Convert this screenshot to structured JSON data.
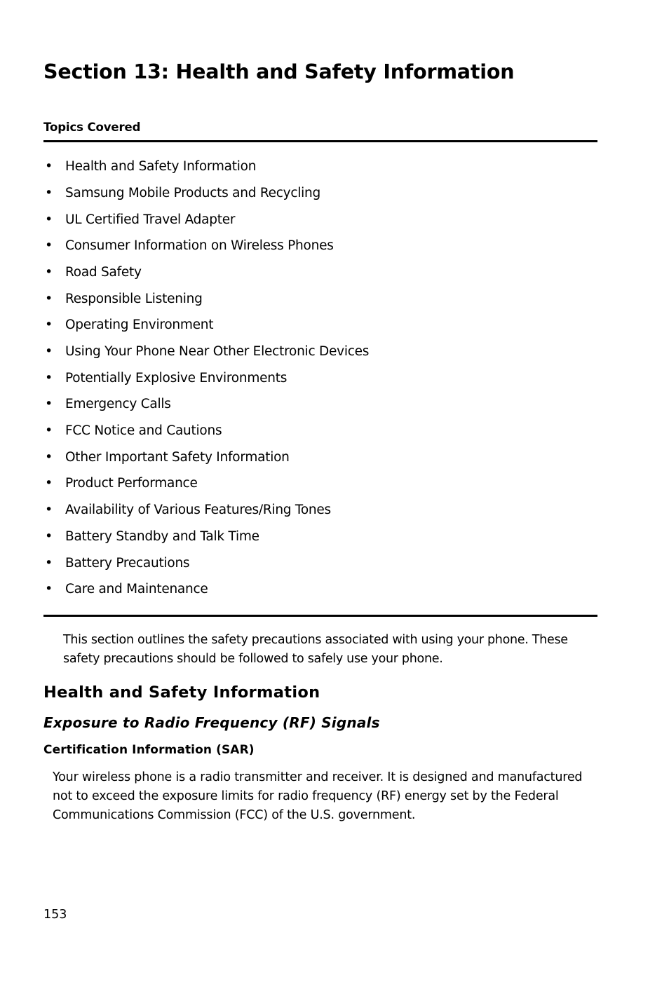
{
  "document": {
    "section_title": "Section 13: Health and Safety Information",
    "topics_label": "Topics Covered",
    "topics": [
      "Health and Safety Information",
      "Samsung Mobile Products and Recycling",
      "UL Certified Travel Adapter",
      "Consumer Information on Wireless Phones",
      "Road Safety",
      "Responsible Listening",
      "Operating Environment",
      "Using Your Phone Near Other Electronic Devices",
      "Potentially Explosive Environments",
      "Emergency Calls",
      "FCC Notice and Cautions",
      "Other Important Safety Information",
      "Product Performance",
      "Availability of Various Features/Ring Tones",
      "Battery Standby and Talk Time",
      "Battery Precautions",
      "Care and Maintenance"
    ],
    "intro_paragraph": "This section outlines the safety precautions associated with using your phone. These safety precautions should be followed to safely use your phone.",
    "heading_health_safety": "Health and Safety Information",
    "heading_rf_signals": "Exposure to Radio Frequency (RF) Signals",
    "heading_certification": "Certification Information (SAR)",
    "certification_paragraph": "Your wireless phone is a radio transmitter and receiver. It is designed and manufactured not to exceed the exposure limits for radio frequency (RF) energy set by the Federal Communications Commission (FCC) of the U.S. government.",
    "page_number": "153"
  }
}
